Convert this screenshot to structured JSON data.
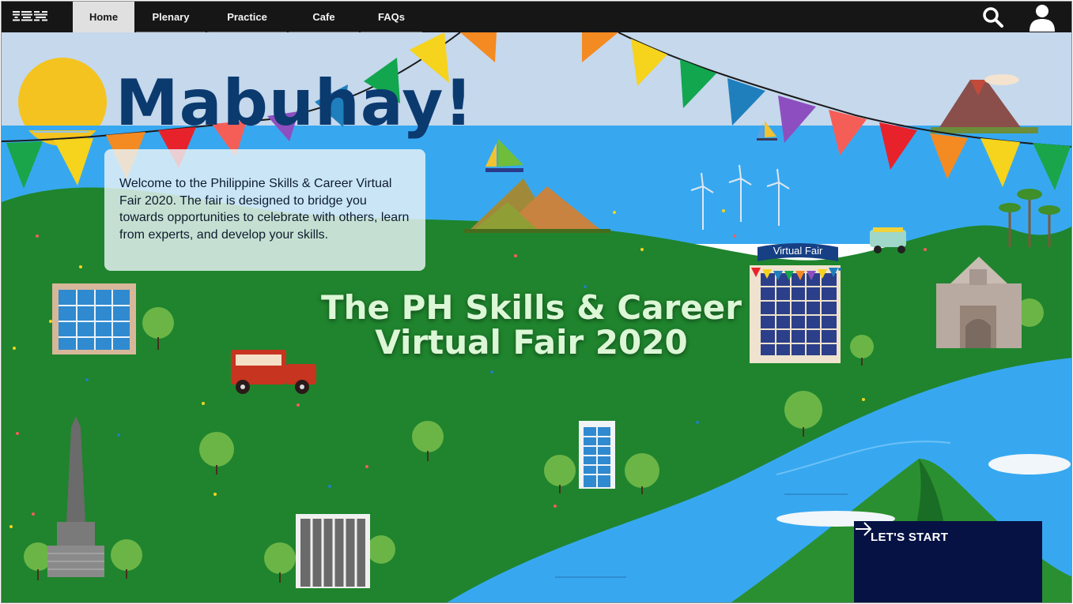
{
  "brand": {
    "logo_text": "IBM",
    "logo_icon": "ibm-logo"
  },
  "nav": {
    "tabs": [
      {
        "label": "Home",
        "active": true
      },
      {
        "label": "Plenary",
        "active": false
      },
      {
        "label": "Practice",
        "active": false
      },
      {
        "label": "Cafe",
        "active": false
      },
      {
        "label": "FAQs",
        "active": false
      }
    ],
    "icons": [
      "search-icon",
      "user-icon"
    ]
  },
  "hero": {
    "title": "Mabuhay!",
    "welcome_text": "Welcome to the Philippine Skills & Career Virtual Fair 2020. The fair is designed to bridge you towards opportunities to celebrate with others, learn from experts, and develop your skills."
  },
  "fair": {
    "title_line1": "The PH Skills & Career",
    "title_line2": "Virtual Fair 2020",
    "building_banner": "Virtual Fair"
  },
  "cta": {
    "label": "LET'S START",
    "icon": "arrow-right-icon"
  },
  "colors": {
    "nav_bg": "#161616",
    "active_tab_bg": "#e0e0e0",
    "sky": "#c5d8ec",
    "sea": "#37a8f0",
    "grass": "#1f842d",
    "hero_title": "#0b3a6f",
    "cta_bg": "#051243"
  }
}
